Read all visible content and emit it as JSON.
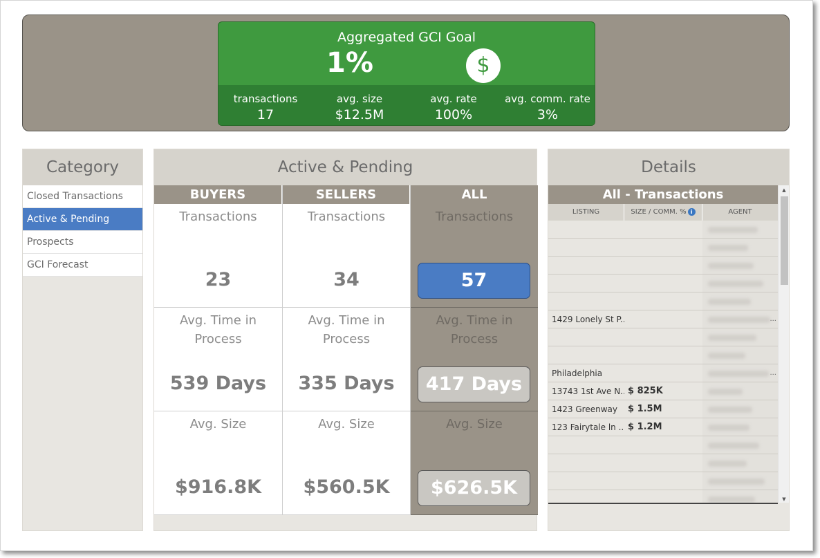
{
  "goal": {
    "title": "Aggregated GCI Goal",
    "percent": "1%",
    "icon": "dollar-icon",
    "icon_glyph": "$",
    "stats": [
      {
        "label": "transactions",
        "value": "17"
      },
      {
        "label": "avg. size",
        "value": "$12.5M"
      },
      {
        "label": "avg. rate",
        "value": "100%"
      },
      {
        "label": "avg. comm. rate",
        "value": "3%"
      }
    ]
  },
  "category": {
    "title": "Category",
    "items": [
      "Closed Transactions",
      "Active & Pending",
      "Prospects",
      "GCI Forecast"
    ],
    "active_index": 1
  },
  "active_pending": {
    "title": "Active & Pending",
    "columns": [
      {
        "header": "BUYERS",
        "transactions_label": "Transactions",
        "transactions": "23",
        "time_label": "Avg. Time in Process",
        "time": "539 Days",
        "size_label": "Avg. Size",
        "size": "$916.8K"
      },
      {
        "header": "SELLERS",
        "transactions_label": "Transactions",
        "transactions": "34",
        "time_label": "Avg. Time in Process",
        "time": "335 Days",
        "size_label": "Avg. Size",
        "size": "$560.5K"
      },
      {
        "header": "ALL",
        "transactions_label": "Transactions",
        "transactions": "57",
        "time_label": "Avg. Time in Process",
        "time": "417 Days",
        "size_label": "Avg. Size",
        "size": "$626.5K"
      }
    ]
  },
  "details": {
    "title": "Details",
    "table_title": "All - Transactions",
    "headers": {
      "listing": "LISTING",
      "size": "SIZE / COMM. %",
      "agent": "AGENT"
    },
    "rows": [
      {
        "listing": "",
        "size": ""
      },
      {
        "listing": "",
        "size": ""
      },
      {
        "listing": "",
        "size": ""
      },
      {
        "listing": "",
        "size": ""
      },
      {
        "listing": "",
        "size": ""
      },
      {
        "listing": "1429 Lonely St P...",
        "size": "",
        "more": "..."
      },
      {
        "listing": "",
        "size": ""
      },
      {
        "listing": "",
        "size": ""
      },
      {
        "listing": "Philadelphia",
        "size": "",
        "more": "..."
      },
      {
        "listing": "13743 1st Ave N...",
        "size": "$ 825K"
      },
      {
        "listing": "1423 Greenway",
        "size": "$ 1.5M"
      },
      {
        "listing": "123 Fairytale ln ...",
        "size": "$ 1.2M"
      },
      {
        "listing": "",
        "size": ""
      },
      {
        "listing": "",
        "size": ""
      },
      {
        "listing": "",
        "size": ""
      },
      {
        "listing": "",
        "size": ""
      }
    ]
  },
  "colors": {
    "banner": "#9a9388",
    "goal_green": "#3f9a3f",
    "goal_dark_green": "#2f7f33",
    "active_blue": "#4a7cc4"
  }
}
